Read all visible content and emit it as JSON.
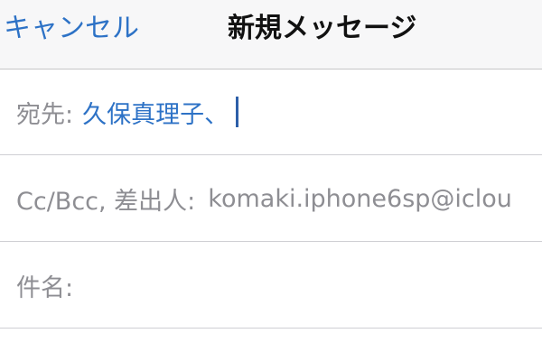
{
  "navbar": {
    "cancel_label": "キャンセル",
    "title": "新規メッセージ"
  },
  "fields": {
    "to": {
      "label": "宛先:",
      "value": "久保真理子、"
    },
    "cc_bcc_from": {
      "label": "Cc/Bcc, 差出人:",
      "value": "komaki.iphone6sp@iclou"
    },
    "subject": {
      "label": "件名:",
      "value": ""
    }
  },
  "colors": {
    "accent": "#2d72c6",
    "label_gray": "#8e8e93",
    "title_text": "#111111",
    "navbar_bg": "#f7f7f8",
    "separator": "#cfcfd3"
  }
}
